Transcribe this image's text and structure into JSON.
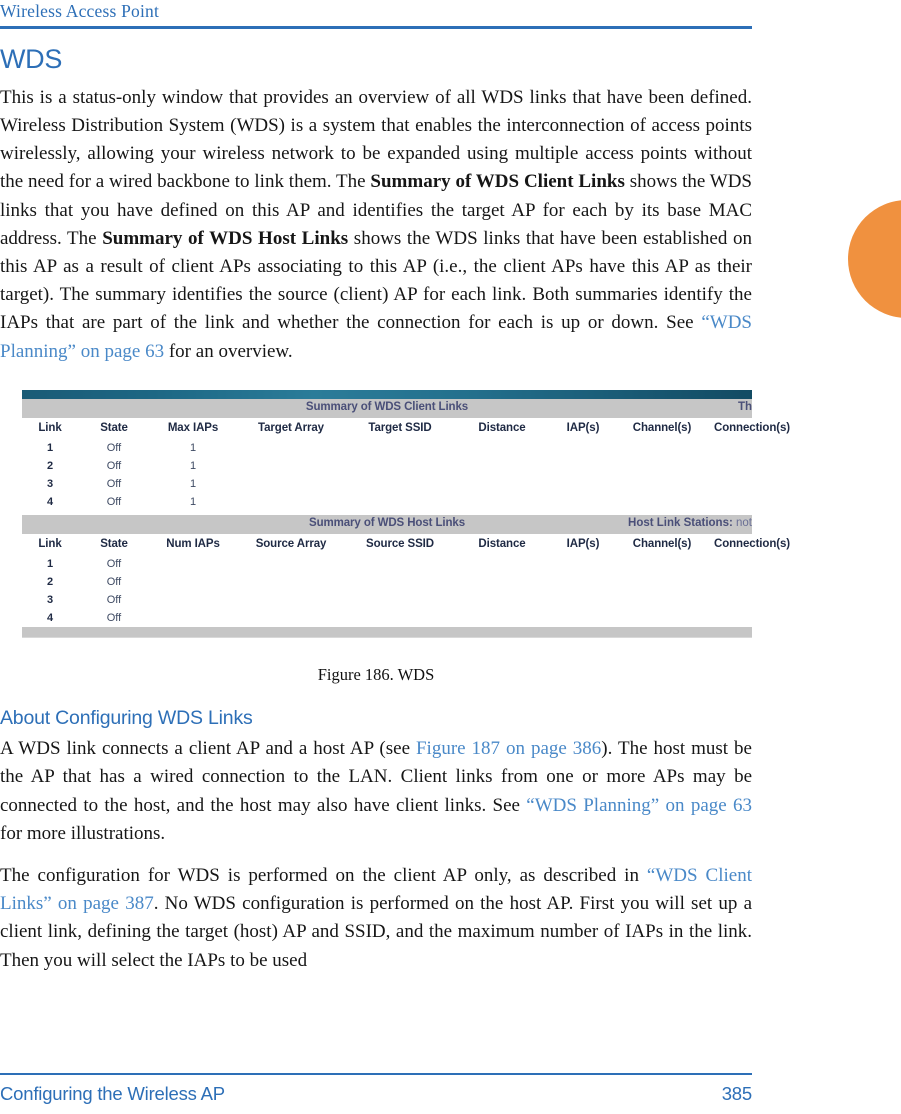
{
  "running_header": {
    "text": "Wireless Access Point"
  },
  "page": {
    "chapter_title": "WDS",
    "intro_parts": {
      "p1_a": "This is a status-only window that provides an overview of all WDS links that have been defined. Wireless Distribution System (WDS) is a system that enables the interconnection of access points wirelessly, allowing your wireless network to be expanded using multiple access points without the need for a wired backbone to link them. The ",
      "p1_b": "Summary of WDS Client Links",
      "p1_c": " shows the WDS links that you have defined on this AP and identifies the target AP for each by its base MAC address. The ",
      "p1_d": "Summary of WDS Host Links",
      "p1_e": " shows the WDS links that have been established on this AP as a result of client APs associating to this AP (i.e., the client APs have this AP as their target). The summary identifies the source (client) AP for each link. Both summaries identify the IAPs that are part of the link and whether the connection for each is up or down. See ",
      "p1_link": "“WDS Planning” on page 63",
      "p1_f": " for an overview."
    },
    "section_title": "About Configuring WDS Links",
    "p2": {
      "a": "A WDS link connects a client AP and a host AP (see ",
      "link1": "Figure 187 on page 386",
      "b": "). The host must be the AP that has a wired connection to the LAN. Client links from one or more APs may be connected to the host, and the host may also have client links. See ",
      "link2": "“WDS Planning” on page 63",
      "c": " for more illustrations."
    },
    "p3": {
      "a": "The configuration for WDS is performed on the client AP only, as described in ",
      "link1": "“WDS Client Links” on page 387",
      "b": ". No WDS configuration is performed on the host AP. First you will set up a client link, defining the target (host) AP and SSID, and the maximum number of IAPs in the link. Then you will select the IAPs to be used"
    },
    "figure_caption": "Figure 186. WDS"
  },
  "screenshot": {
    "client_links": {
      "section_title": "Summary of WDS Client Links",
      "section_right_truncated": "Th",
      "columns": [
        "Link",
        "State",
        "Max IAPs",
        "Target Array",
        "Target SSID",
        "Distance",
        "IAP(s)",
        "Channel(s)",
        "Connection(s)"
      ],
      "rows": [
        {
          "link": "1",
          "state": "Off",
          "max_iaps": "1",
          "target_array": "",
          "target_ssid": "",
          "distance": "",
          "iaps": "",
          "channels": "",
          "connections": ""
        },
        {
          "link": "2",
          "state": "Off",
          "max_iaps": "1",
          "target_array": "",
          "target_ssid": "",
          "distance": "",
          "iaps": "",
          "channels": "",
          "connections": ""
        },
        {
          "link": "3",
          "state": "Off",
          "max_iaps": "1",
          "target_array": "",
          "target_ssid": "",
          "distance": "",
          "iaps": "",
          "channels": "",
          "connections": ""
        },
        {
          "link": "4",
          "state": "Off",
          "max_iaps": "1",
          "target_array": "",
          "target_ssid": "",
          "distance": "",
          "iaps": "",
          "channels": "",
          "connections": ""
        }
      ]
    },
    "host_links": {
      "section_title": "Summary of WDS Host Links",
      "section_right_label": "Host Link Stations:",
      "section_right_value": "not",
      "columns": [
        "Link",
        "State",
        "Num IAPs",
        "Source Array",
        "Source SSID",
        "Distance",
        "IAP(s)",
        "Channel(s)",
        "Connection(s)"
      ],
      "rows": [
        {
          "link": "1",
          "state": "Off",
          "num_iaps": "",
          "source_array": "",
          "source_ssid": "",
          "distance": "",
          "iaps": "",
          "channels": "",
          "connections": ""
        },
        {
          "link": "2",
          "state": "Off",
          "num_iaps": "",
          "source_array": "",
          "source_ssid": "",
          "distance": "",
          "iaps": "",
          "channels": "",
          "connections": ""
        },
        {
          "link": "3",
          "state": "Off",
          "num_iaps": "",
          "source_array": "",
          "source_ssid": "",
          "distance": "",
          "iaps": "",
          "channels": "",
          "connections": ""
        },
        {
          "link": "4",
          "state": "Off",
          "num_iaps": "",
          "source_array": "",
          "source_ssid": "",
          "distance": "",
          "iaps": "",
          "channels": "",
          "connections": ""
        }
      ]
    }
  },
  "footer": {
    "left": "Configuring the Wireless AP",
    "page_number": "385"
  },
  "colors": {
    "accent_blue": "#2d6fb7",
    "link_blue": "#4a89c8",
    "tab_orange": "#f0913f",
    "teal_dark": "#1a5b76",
    "teal_light": "#2b7c99",
    "bar_gray": "#c6c6c6"
  }
}
